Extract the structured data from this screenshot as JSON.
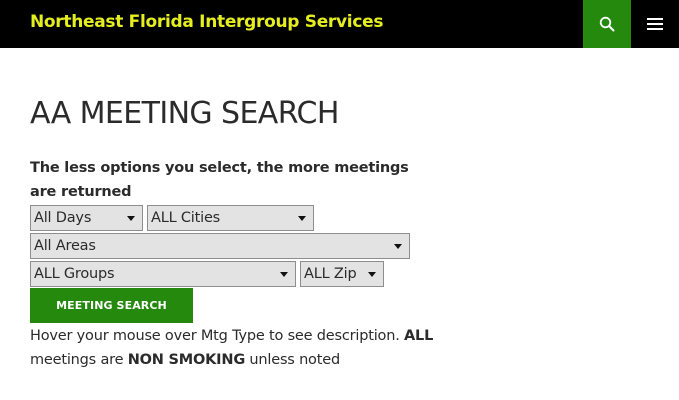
{
  "header": {
    "site_title": "Northeast Florida Intergroup Services",
    "search_icon": "search-icon",
    "menu_icon": "hamburger-menu-icon",
    "colors": {
      "bar": "#000000",
      "title": "#e5ee1f",
      "accent": "#24890d"
    }
  },
  "main": {
    "page_title": "AA MEETING SEARCH",
    "intro": "The less options you select, the more meetings are returned",
    "filters": {
      "days": "All Days",
      "cities": "ALL Cities",
      "areas": "All Areas",
      "groups": "ALL Groups",
      "zip": "ALL Zip"
    },
    "search_button": "MEETING SEARCH",
    "note": {
      "part1": "Hover your mouse over Mtg Type to see description. ",
      "part2": "ALL",
      "part3": " meetings are ",
      "part4": "NON SMOKING",
      "part5": " unless noted"
    }
  }
}
